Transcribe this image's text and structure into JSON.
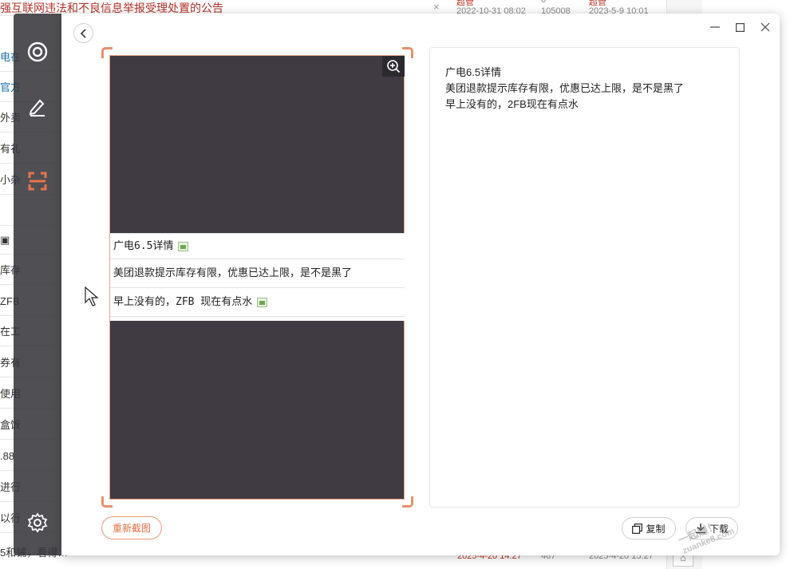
{
  "background": {
    "notice_title": "强互联网违法和不良信息举报受理处置的公告",
    "notice_close": "×",
    "meta_author": "超管",
    "meta_count": "0",
    "meta_date": "2022-10-31 08:02",
    "meta_views": "105008",
    "meta_last_date": "2023-5-9 10:01",
    "rows": [
      {
        "text": "电在"
      },
      {
        "text": "官方"
      },
      {
        "text": "外卖"
      },
      {
        "text": "有礼"
      },
      {
        "text": "小杂"
      },
      {
        "text": ""
      },
      {
        "text": "▣"
      },
      {
        "text": "库存"
      },
      {
        "text": "ZFB"
      },
      {
        "text": "在工"
      },
      {
        "text": "券有"
      },
      {
        "text": "使用"
      },
      {
        "text": "盒饭"
      },
      {
        "text": ".88"
      },
      {
        "text": "进行"
      },
      {
        "text": "以行"
      }
    ],
    "bottom_row_text": "5和铺，看得…",
    "bottom_time": "2025-4-20 14:27",
    "bottom_views": "467",
    "bottom_last": "2025-4-20 15:27",
    "scroll_up_label": "⌂"
  },
  "sidebar": {
    "tools": [
      {
        "name": "ocr-target-icon"
      },
      {
        "name": "edit-pen-icon"
      },
      {
        "name": "scan-frame-icon"
      },
      {
        "name": "settings-gear-icon"
      }
    ]
  },
  "window": {
    "back_label": "‹",
    "minimize_label": "—",
    "maximize_label": "□",
    "close_label": "✕"
  },
  "screenshot": {
    "lines": [
      "广电6.5详情",
      "美团退款提示库存有限，优惠已达上限，是不是黑了",
      "早上没有的，ZFB 现在有点水"
    ]
  },
  "ocr_result": {
    "lines": [
      "广电6.5详情",
      "美团退款提示库存有限，优惠已达上限，是不是黑了",
      "早上没有的，2FB现在有点水"
    ]
  },
  "actions": {
    "recapture_label": "重新截图",
    "copy_label": "复制",
    "download_label": "下载"
  },
  "watermark": {
    "text": "一起赚！",
    "site": "zuanke8.com"
  }
}
